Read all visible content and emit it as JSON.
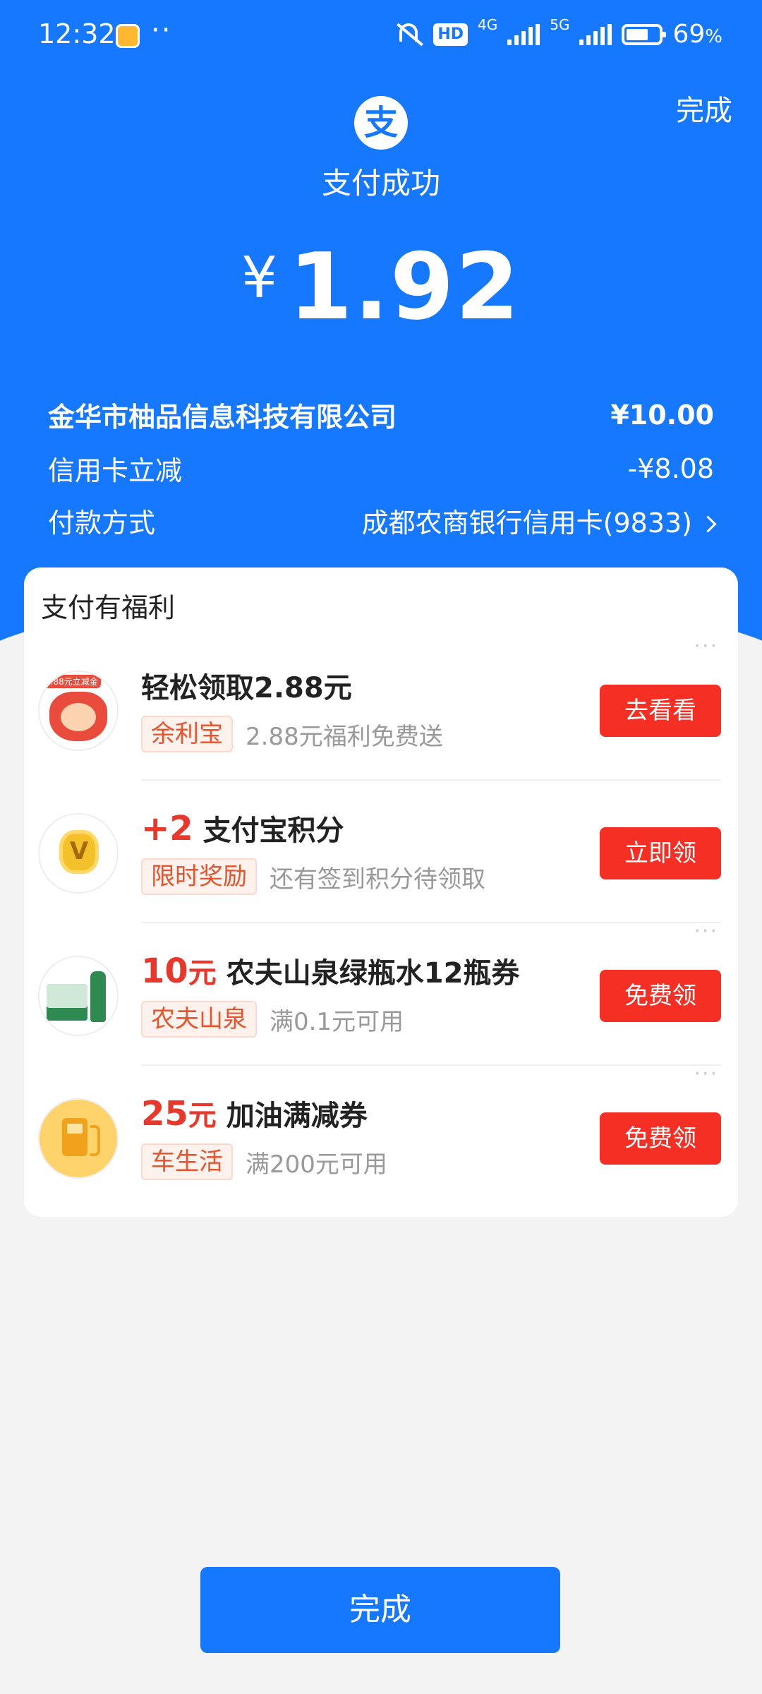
{
  "status_bar": {
    "time": "12:32",
    "dots": "··",
    "hd": "HD",
    "net1": "4G",
    "net2": "5G",
    "battery": "69",
    "battery_unit": "%"
  },
  "header": {
    "done_label": "完成",
    "logo_char": "支",
    "title": "支付成功",
    "currency": "¥",
    "amount": "1.92"
  },
  "details": {
    "merchant": {
      "label": "金华市柚品信息科技有限公司",
      "value": "¥10.00"
    },
    "discount": {
      "label": "信用卡立减",
      "value": "-¥8.08"
    },
    "method": {
      "label": "付款方式",
      "value": "成都农商银行信用卡(9833)"
    }
  },
  "benefits": {
    "title": "支付有福利",
    "items": [
      {
        "icon": "money-pouch-icon",
        "icon_text": "2.88元立减金",
        "title_highlight": "",
        "title_unit": "",
        "title": "轻松领取2.88元",
        "tag": "余利宝",
        "desc": "2.88元福利免费送",
        "button": "去看看"
      },
      {
        "icon": "points-medal-icon",
        "icon_text": "V",
        "title_highlight": "+2",
        "title_unit": "",
        "title": "支付宝积分",
        "tag": "限时奖励",
        "desc": "还有签到积分待领取",
        "button": "立即领"
      },
      {
        "icon": "water-bottles-icon",
        "title_highlight": "10",
        "title_unit": "元",
        "title": "农夫山泉绿瓶水12瓶券",
        "tag": "农夫山泉",
        "desc": "满0.1元可用",
        "button": "免费领"
      },
      {
        "icon": "fuel-pump-icon",
        "title_highlight": "25",
        "title_unit": "元",
        "title": "加油满减券",
        "tag": "车生活",
        "desc": "满200元可用",
        "button": "免费领"
      }
    ],
    "more": "···"
  },
  "footer": {
    "done_label": "完成"
  },
  "colors": {
    "primary": "#1677ff",
    "button_red": "#f52f24",
    "tag_orange": "#e8532c"
  }
}
